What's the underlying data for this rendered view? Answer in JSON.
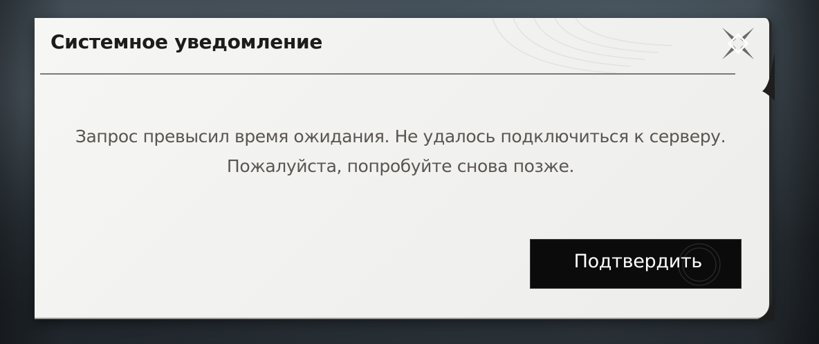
{
  "dialog": {
    "title": "Системное уведомление",
    "message": "Запрос превысил время ожидания. Не удалось подключиться к серверу. Пожалуйста, попробуйте снова позже.",
    "confirm_label": "Подтвердить",
    "close_icon": "close-icon"
  },
  "colors": {
    "panel": "#f3f3f1",
    "title_text": "#1c1c1c",
    "message_text": "#5a5550",
    "button_bg": "#0b0b0b",
    "button_text": "#ffffff",
    "close_icon": "#6e6a62"
  }
}
